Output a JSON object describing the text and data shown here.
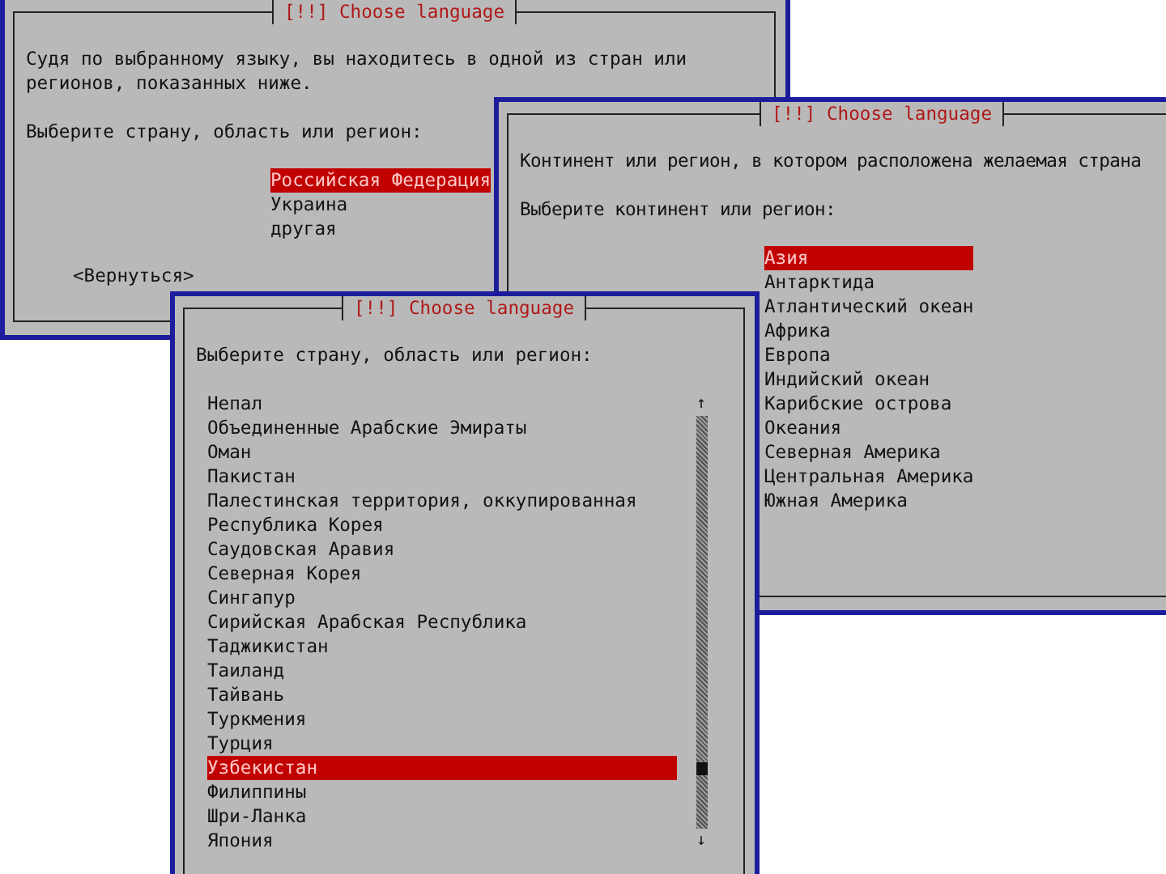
{
  "dialogs": [
    {
      "kind": "choice",
      "title": "[!!] Choose language",
      "paragraphs": [
        "Судя по выбранному языку, вы находитесь в одной из стран или регионов, показанных ниже.",
        "Выберите страну, область или регион:"
      ],
      "options": [
        {
          "label": "Российская Федерация",
          "selected": true
        },
        {
          "label": "Украина",
          "selected": false
        },
        {
          "label": "другая",
          "selected": false
        }
      ],
      "buttons": [
        "<Вернуться>"
      ]
    },
    {
      "kind": "choice",
      "title": "[!!] Choose language",
      "paragraphs": [
        "Континент или регион, в котором расположена желаемая страна",
        "Выберите континент или регион:"
      ],
      "options": [
        {
          "label": "Азия",
          "selected": true
        },
        {
          "label": "Антарктида",
          "selected": false
        },
        {
          "label": "Атлантический океан",
          "selected": false
        },
        {
          "label": "Африка",
          "selected": false
        },
        {
          "label": "Европа",
          "selected": false
        },
        {
          "label": "Индийский океан",
          "selected": false
        },
        {
          "label": "Карибские острова",
          "selected": false
        },
        {
          "label": "Океания",
          "selected": false
        },
        {
          "label": "Северная Америка",
          "selected": false
        },
        {
          "label": "Центральная Америка",
          "selected": false
        },
        {
          "label": "Южная Америка",
          "selected": false
        }
      ]
    },
    {
      "kind": "scroll",
      "title": "[!!] Choose language",
      "paragraphs": [
        "Выберите страну, область или регион:"
      ],
      "options": [
        {
          "label": "Непал",
          "selected": false
        },
        {
          "label": "Объединенные Арабские Эмираты",
          "selected": false
        },
        {
          "label": "Оман",
          "selected": false
        },
        {
          "label": "Пакистан",
          "selected": false
        },
        {
          "label": "Палестинская территория, оккупированная",
          "selected": false
        },
        {
          "label": "Республика Корея",
          "selected": false
        },
        {
          "label": "Саудовская Аравия",
          "selected": false
        },
        {
          "label": "Северная Корея",
          "selected": false
        },
        {
          "label": "Сингапур",
          "selected": false
        },
        {
          "label": "Сирийская Арабская Республика",
          "selected": false
        },
        {
          "label": "Таджикистан",
          "selected": false
        },
        {
          "label": "Таиланд",
          "selected": false
        },
        {
          "label": "Тайвань",
          "selected": false
        },
        {
          "label": "Туркмения",
          "selected": false
        },
        {
          "label": "Турция",
          "selected": false
        },
        {
          "label": "Узбекистан",
          "selected": true
        },
        {
          "label": "Филиппины",
          "selected": false
        },
        {
          "label": "Шри-Ланка",
          "selected": false
        },
        {
          "label": "Япония",
          "selected": false
        }
      ],
      "scroll_up": "↑",
      "scroll_down": "↓"
    }
  ]
}
